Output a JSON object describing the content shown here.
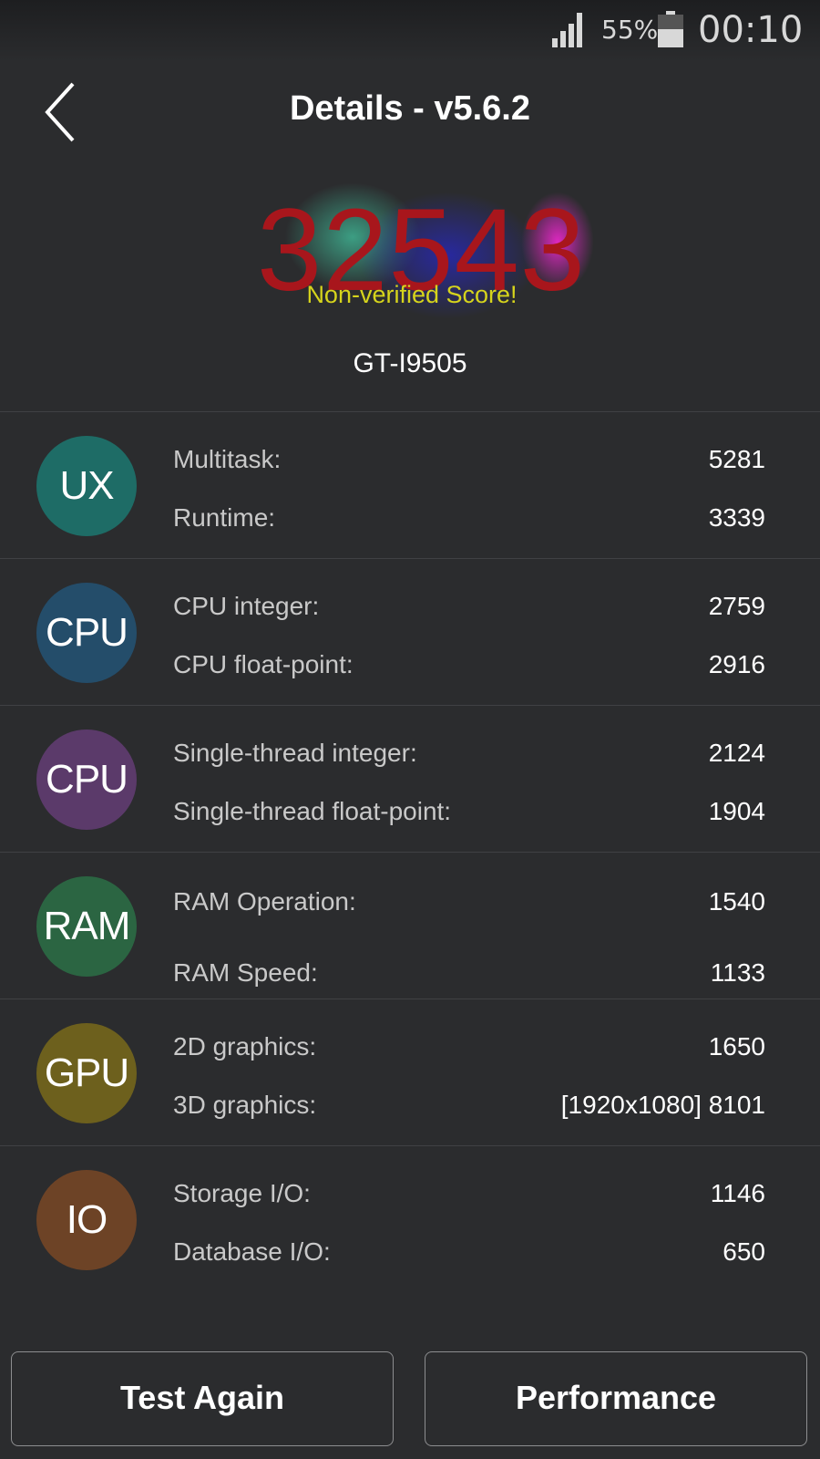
{
  "status_bar": {
    "battery_percent": "55%",
    "time": "00:10",
    "signal_icon": "signal-icon",
    "battery_icon": "battery-icon"
  },
  "header": {
    "title": "Details - v5.6.2",
    "back_icon": "chevron-left-icon"
  },
  "summary": {
    "score": "32543",
    "score_note": "Non-verified Score!",
    "device": "GT-I9505",
    "colors": {
      "score": "#a8161c",
      "note": "#d6d41c"
    }
  },
  "categories": [
    {
      "badge": "UX",
      "color": "#1e6c66",
      "items": [
        {
          "label": "Multitask:",
          "value": "5281"
        },
        {
          "label": "Runtime:",
          "value": "3339"
        }
      ]
    },
    {
      "badge": "CPU",
      "color": "#244d6a",
      "items": [
        {
          "label": "CPU integer:",
          "value": "2759"
        },
        {
          "label": "CPU float-point:",
          "value": "2916"
        }
      ]
    },
    {
      "badge": "CPU",
      "color": "#5b3a6a",
      "items": [
        {
          "label": "Single-thread integer:",
          "value": "2124"
        },
        {
          "label": "Single-thread float-point:",
          "value": "1904"
        }
      ]
    },
    {
      "badge": "RAM",
      "color": "#2b6542",
      "items": [
        {
          "label": "RAM Operation:",
          "value": "1540"
        },
        {
          "label": "RAM Speed:",
          "value": "1133"
        }
      ]
    },
    {
      "badge": "GPU",
      "color": "#6d601d",
      "items": [
        {
          "label": "2D graphics:",
          "value": "1650"
        },
        {
          "label": "3D graphics:",
          "value": "[1920x1080] 8101"
        }
      ]
    },
    {
      "badge": "IO",
      "color": "#6d4326",
      "items": [
        {
          "label": "Storage I/O:",
          "value": "1146"
        },
        {
          "label": "Database I/O:",
          "value": "650"
        }
      ]
    }
  ],
  "buttons": {
    "test_again": "Test Again",
    "performance": "Performance"
  }
}
